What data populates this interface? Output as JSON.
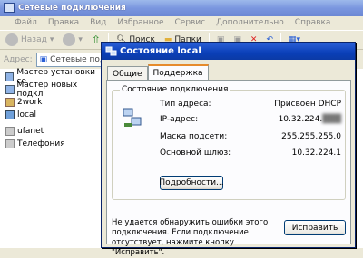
{
  "window": {
    "title": "Сетевые подключения"
  },
  "menu": [
    "Файл",
    "Правка",
    "Вид",
    "Избранное",
    "Сервис",
    "Дополнительно",
    "Справка"
  ],
  "toolbar": {
    "back": "Назад",
    "search": "Поиск",
    "folders": "Папки"
  },
  "address": {
    "label": "Адрес:",
    "value": "Сетевые подк"
  },
  "connections": [
    {
      "label": "Мастер установки се",
      "icon": "wizard-icon"
    },
    {
      "label": "Мастер новых подкл",
      "icon": "wizard-icon"
    },
    {
      "label": "2work",
      "icon": "dialup-icon"
    },
    {
      "label": "local",
      "icon": "lan-icon"
    },
    {
      "label": "ufanet",
      "icon": "broadband-icon"
    },
    {
      "label": "Телефония",
      "icon": "broadband-icon"
    }
  ],
  "dialog": {
    "title": "Состояние local",
    "tabs": [
      "Общие",
      "Поддержка"
    ],
    "active_tab": "Поддержка",
    "group_title": "Состояние подключения",
    "fields": [
      {
        "key": "Тип адреса:",
        "value": "Присвоен DHCP"
      },
      {
        "key": "IP-адрес:",
        "value": "10.32.224."
      },
      {
        "key": "Маска подсети:",
        "value": "255.255.255.0"
      },
      {
        "key": "Основной шлюз:",
        "value": "10.32.224.1"
      }
    ],
    "details_button": "Подробности...",
    "message": "Не удается обнаружить ошибки этого подключения. Если подключение отсутствует, нажмите кнопку \"Исправить\".",
    "repair_button": "Исправить"
  }
}
